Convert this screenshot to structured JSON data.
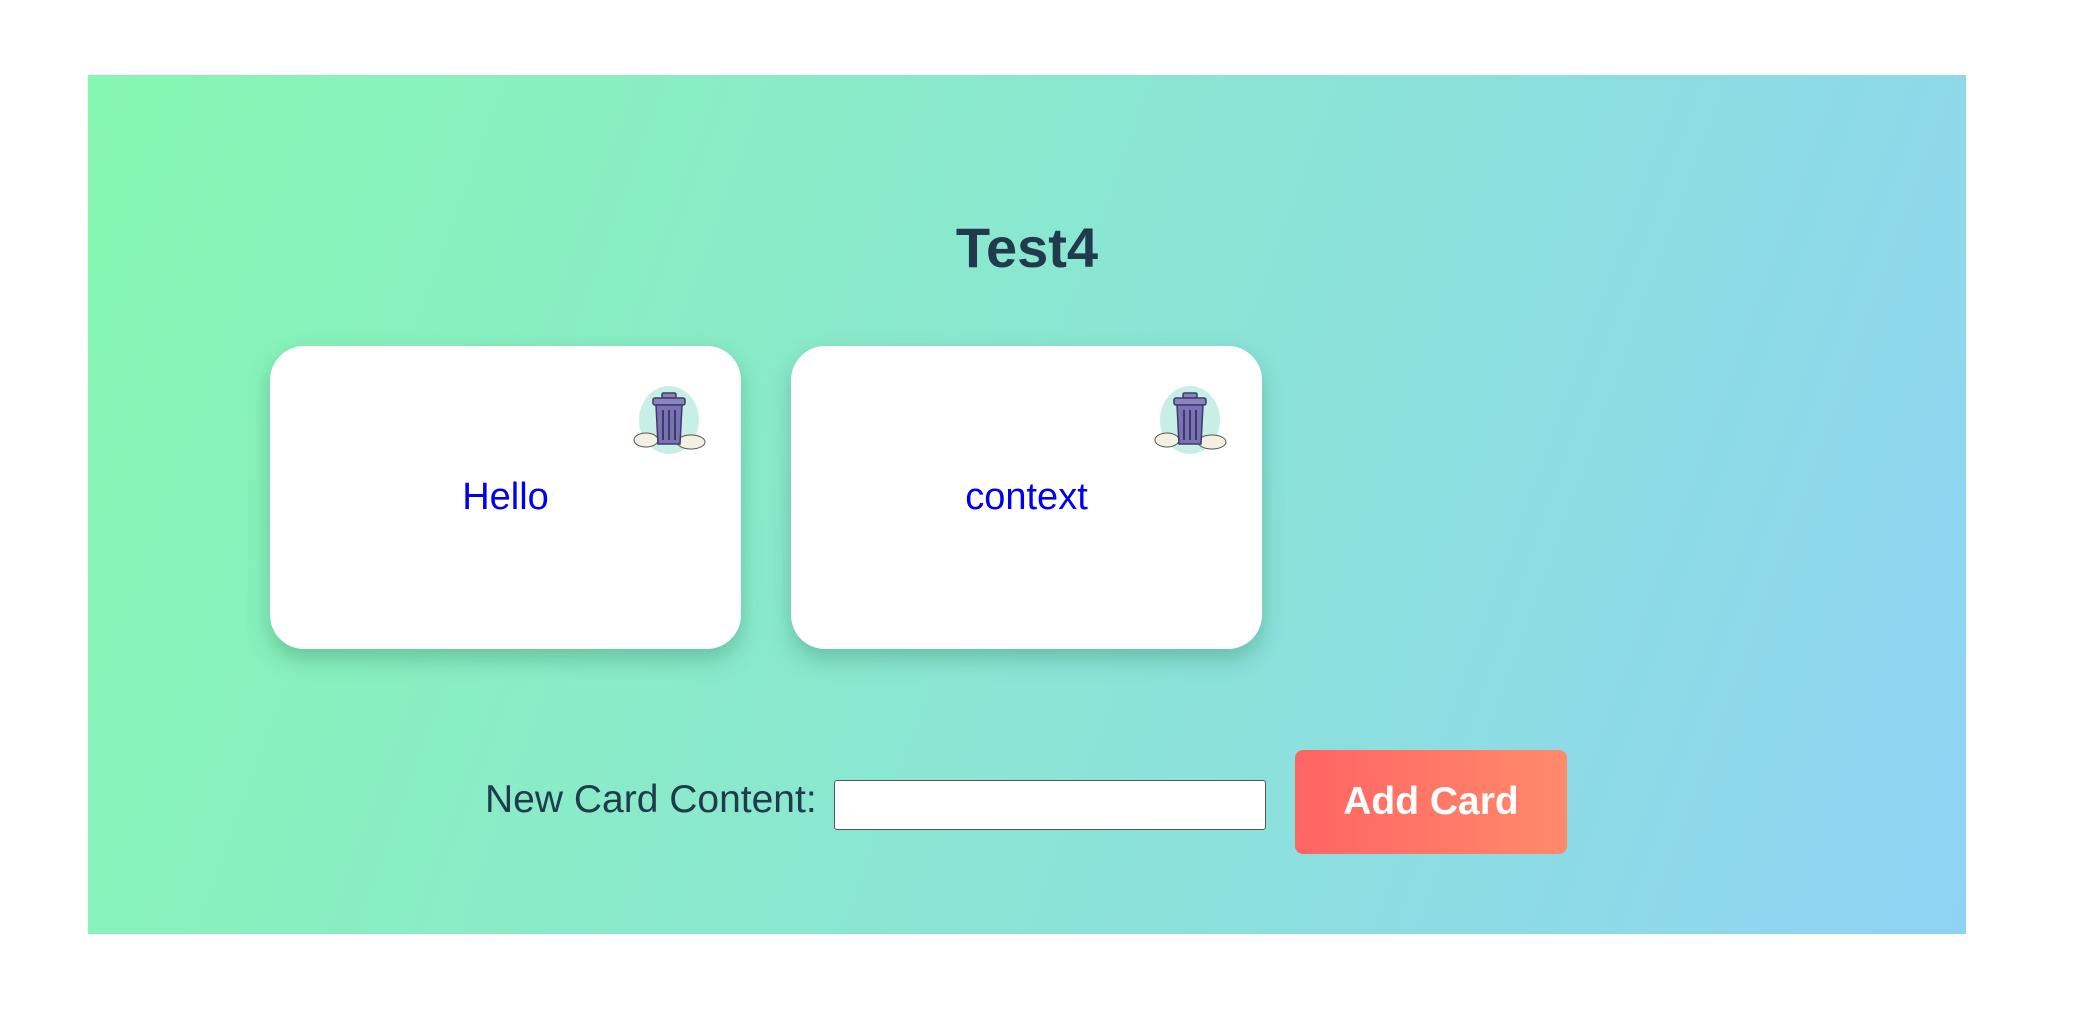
{
  "board": {
    "title": "Test4"
  },
  "cards": [
    {
      "content": "Hello",
      "delete_icon": "trash-can-icon"
    },
    {
      "content": "context",
      "delete_icon": "trash-can-icon"
    }
  ],
  "add_form": {
    "label": "New Card Content:",
    "input_value": "",
    "input_placeholder": "",
    "button_label": "Add Card"
  },
  "colors": {
    "gradient_start": "#86f7b1",
    "gradient_end": "#8fd3f4",
    "title": "#213a4d",
    "card_text": "#0000ee",
    "button_start": "#ff6464",
    "button_end": "#ff8a6a"
  }
}
